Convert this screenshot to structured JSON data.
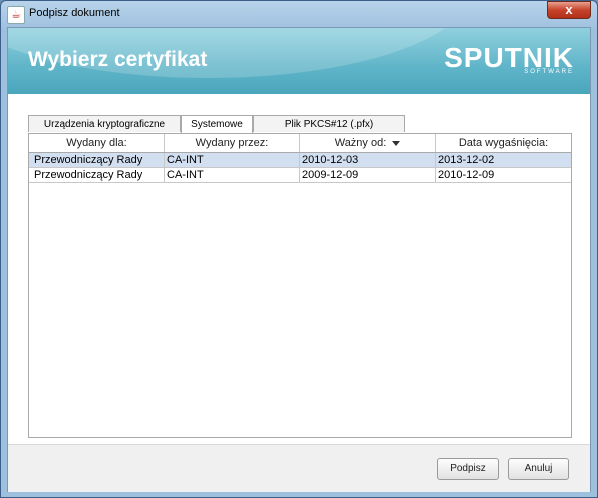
{
  "window": {
    "title": "Podpisz dokument",
    "close_label": "x"
  },
  "header": {
    "title": "Wybierz certyfikat",
    "logo_main": "SPUTNIK",
    "logo_sub": "SOFTWARE"
  },
  "tabs": [
    {
      "label": "Urządzenia kryptograficzne",
      "active": false
    },
    {
      "label": "Systemowe",
      "active": true
    },
    {
      "label": "Plik PKCS#12 (.pfx)",
      "active": false
    }
  ],
  "table": {
    "columns": [
      "Wydany dla:",
      "Wydany przez:",
      "Ważny od:",
      "Data wygaśnięcia:"
    ],
    "sort_column": "Ważny od:",
    "rows": [
      {
        "for": "Przewodniczący Rady",
        "by": "CA-INT",
        "from": "2010-12-03",
        "expires": "2013-12-02",
        "selected": true
      },
      {
        "for": "Przewodniczący Rady",
        "by": "CA-INT",
        "from": "2009-12-09",
        "expires": "2010-12-09",
        "selected": false
      }
    ]
  },
  "buttons": {
    "sign": "Podpisz",
    "cancel": "Anuluj"
  },
  "colors": {
    "header_accent": "#5fb4c8",
    "selected_row": "#d2dff0"
  }
}
